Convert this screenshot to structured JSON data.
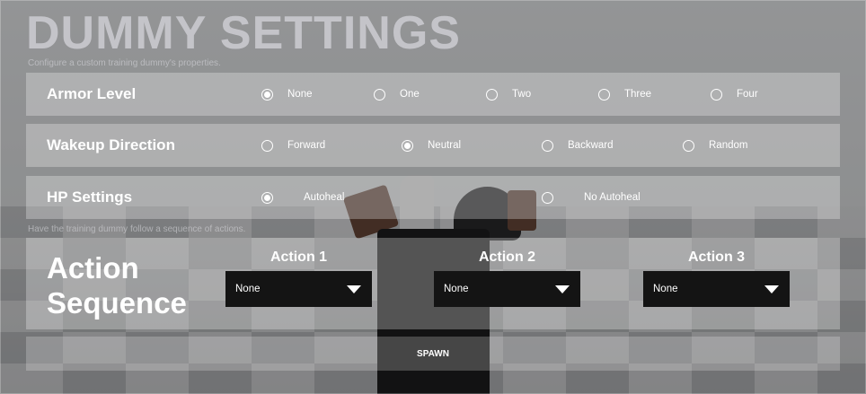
{
  "header": {
    "title": "DUMMY SETTINGS",
    "subtitle": "Configure a custom training dummy's properties."
  },
  "armor": {
    "label": "Armor Level",
    "options": [
      "None",
      "One",
      "Two",
      "Three",
      "Four"
    ],
    "selected": "None"
  },
  "wakeup": {
    "label": "Wakeup Direction",
    "options": [
      "Forward",
      "Neutral",
      "Backward",
      "Random"
    ],
    "selected": "Neutral"
  },
  "hp": {
    "label": "HP Settings",
    "options": [
      "Autoheal",
      "No Autoheal"
    ],
    "selected": "Autoheal"
  },
  "sequence": {
    "hint": "Have the training dummy follow a sequence of actions.",
    "title_line1": "Action",
    "title_line2": "Sequence",
    "actions": [
      {
        "label": "Action 1",
        "value": "None"
      },
      {
        "label": "Action 2",
        "value": "None"
      },
      {
        "label": "Action 3",
        "value": "None"
      }
    ]
  },
  "spawn_label": "SPAWN",
  "colors": {
    "panel_overlay": "#00000061",
    "row_bg": "#ffffff47",
    "dropdown_bg": "#141414",
    "text": "#ffffff"
  }
}
